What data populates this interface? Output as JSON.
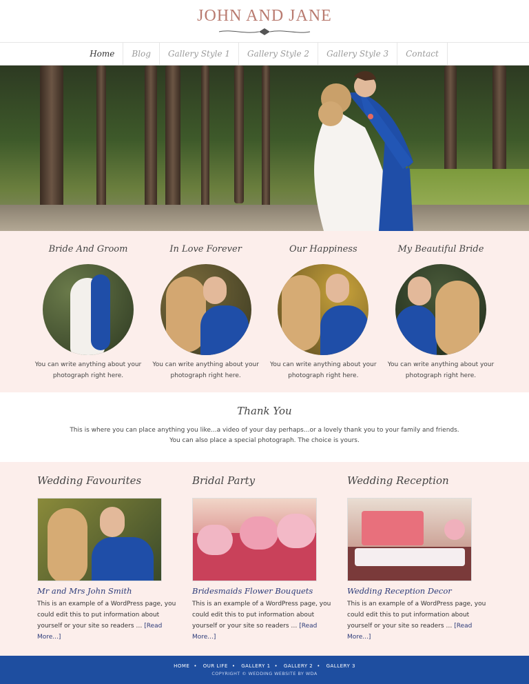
{
  "site": {
    "title": "John and Jane"
  },
  "nav": {
    "items": [
      {
        "label": "Home"
      },
      {
        "label": "Blog"
      },
      {
        "label": "Gallery Style 1"
      },
      {
        "label": "Gallery Style 2"
      },
      {
        "label": "Gallery Style 3"
      },
      {
        "label": "Contact"
      }
    ]
  },
  "photos": [
    {
      "title": "Bride And Groom",
      "caption1": "You can write anything about your",
      "caption2": "photograph right here."
    },
    {
      "title": "In Love Forever",
      "caption1": "You can write anything about your",
      "caption2": "photograph right here."
    },
    {
      "title": "Our Happiness",
      "caption1": "You can write anything about your",
      "caption2": "photograph right here."
    },
    {
      "title": "My Beautiful Bride",
      "caption1": "You can write anything about your",
      "caption2": "photograph right here."
    }
  ],
  "thanks": {
    "title": "Thank You",
    "line1": "This is where you can place anything you like...a video of your day perhaps...or a lovely thank you to your family and friends.",
    "line2": "You can also place a special photograph. The choice is yours."
  },
  "features": [
    {
      "title": "Wedding Favourites",
      "subtitle": "Mr and Mrs John Smith",
      "text": "This is an example of a WordPress page, you could edit this to put information about yourself or your site so readers …",
      "more": "[Read More...]"
    },
    {
      "title": "Bridal Party",
      "subtitle": "Bridesmaids Flower Bouquets",
      "text": "This is an example of a WordPress page, you could edit this to put information about yourself or your site so readers …",
      "more": "[Read More...]"
    },
    {
      "title": "Wedding Reception",
      "subtitle": "Wedding Reception Decor",
      "text": "This is an example of a WordPress page, you could edit this to put information about yourself or your site so readers …",
      "more": "[Read More...]"
    }
  ],
  "footer": {
    "links": [
      "HOME",
      "OUR LIFE",
      "GALLERY 1",
      "GALLERY 2",
      "GALLERY 3"
    ],
    "copyright": "COPYRIGHT © WEDDING WEBSITE BY WDA"
  },
  "colors": {
    "brand": "#b97b70",
    "pink_bg": "#fceeeb",
    "footer_bg": "#1e4ea0",
    "link": "#2b3a78"
  }
}
